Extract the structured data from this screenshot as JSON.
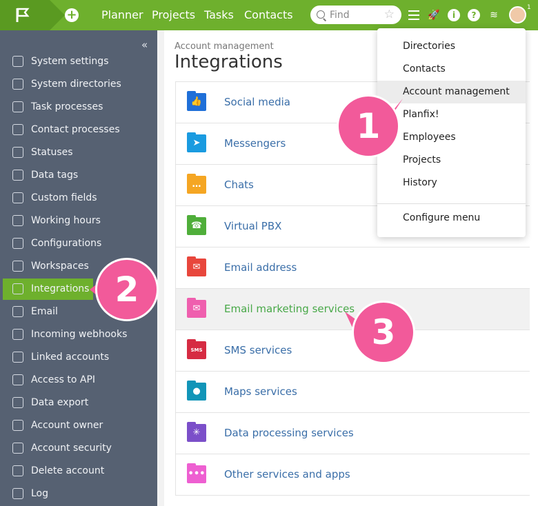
{
  "topbar": {
    "nav": [
      "Planner",
      "Projects",
      "Tasks",
      "Contacts"
    ],
    "search_placeholder": "Find",
    "avatar_badge": "1"
  },
  "sidebar": {
    "collapse_icon": "«",
    "items": [
      {
        "label": "System settings",
        "icon": "sliders-icon"
      },
      {
        "label": "System directories",
        "icon": "directory-icon"
      },
      {
        "label": "Task processes",
        "icon": "process-icon"
      },
      {
        "label": "Contact processes",
        "icon": "contact-process-icon"
      },
      {
        "label": "Statuses",
        "icon": "status-icon"
      },
      {
        "label": "Data tags",
        "icon": "tag-icon"
      },
      {
        "label": "Custom fields",
        "icon": "fields-icon"
      },
      {
        "label": "Working hours",
        "icon": "clock-icon"
      },
      {
        "label": "Configurations",
        "icon": "config-icon"
      },
      {
        "label": "Workspaces",
        "icon": "rocket-icon"
      },
      {
        "label": "Integrations",
        "icon": "integrations-icon",
        "active": true
      },
      {
        "label": "Email",
        "icon": "mail-icon"
      },
      {
        "label": "Incoming webhooks",
        "icon": "webhook-icon"
      },
      {
        "label": "Linked accounts",
        "icon": "link-icon"
      },
      {
        "label": "Access to API",
        "icon": "api-icon"
      },
      {
        "label": "Data export",
        "icon": "export-icon"
      },
      {
        "label": "Account owner",
        "icon": "user-icon"
      },
      {
        "label": "Account security",
        "icon": "shield-icon"
      },
      {
        "label": "Delete account",
        "icon": "trash-icon"
      },
      {
        "label": "Log",
        "icon": "log-icon"
      }
    ]
  },
  "main": {
    "breadcrumb": "Account management",
    "title": "Integrations",
    "rows": [
      {
        "label": "Social media",
        "color": "#1f6fd8",
        "glyph": "👍"
      },
      {
        "label": "Messengers",
        "color": "#1a9be0",
        "glyph": "➤"
      },
      {
        "label": "Chats",
        "color": "#f5a623",
        "glyph": "…"
      },
      {
        "label": "Virtual PBX",
        "color": "#4fae3a",
        "glyph": "☎"
      },
      {
        "label": "Email address",
        "color": "#e8463c",
        "glyph": "✉"
      },
      {
        "label": "Email marketing services",
        "color": "#ef5fae",
        "glyph": "✉",
        "highlighted": true
      },
      {
        "label": "SMS services",
        "color": "#d62b42",
        "glyph": "SMS"
      },
      {
        "label": "Maps services",
        "color": "#1195b8",
        "glyph": "●"
      },
      {
        "label": "Data processing services",
        "color": "#7b4fc9",
        "glyph": "✳"
      },
      {
        "label": "Other services and apps",
        "color": "#ee5fd1",
        "glyph": "•••"
      }
    ]
  },
  "dropdown": {
    "items": [
      "Directories",
      "Contacts",
      "Account management",
      "Planfix!",
      "Employees",
      "Projects",
      "History"
    ],
    "selected": "Account management",
    "footer": "Configure menu"
  },
  "callouts": [
    "1",
    "2",
    "3"
  ]
}
